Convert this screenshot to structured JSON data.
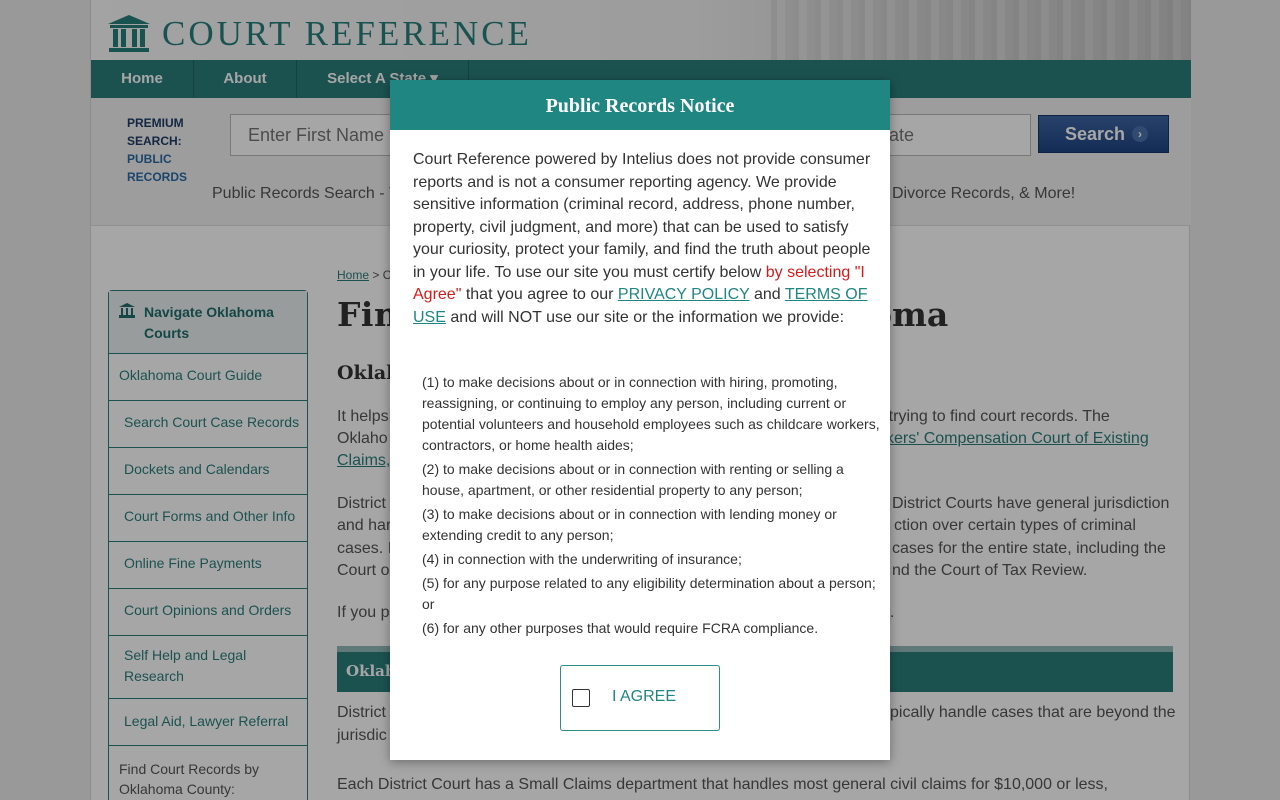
{
  "brand": {
    "name": "COURT REFERENCE",
    "color": "#27807c"
  },
  "nav": {
    "home": "Home",
    "about": "About",
    "select_state": "Select A State"
  },
  "search": {
    "premium_label_1": "PREMIUM",
    "premium_label_2": "SEARCH:",
    "premium_label_3": "PUBLIC",
    "premium_label_4": "RECORDS",
    "first_name_placeholder": "Enter First Name",
    "state_placeholder": "State",
    "button": "Search",
    "tagline_left": "Public Records Search - Y",
    "tagline_right": "Divorce Records, & More!"
  },
  "sidebar": {
    "heading": "Navigate Oklahoma Courts",
    "items": [
      "Oklahoma Court Guide",
      "Search Court Case Records",
      "Dockets and Calendars",
      "Court Forms and Other Info",
      "Online Fine Payments",
      "Court Opinions and Orders",
      "Self Help and Legal Research",
      "Legal Aid, Lawyer Referral",
      "Find Court Records by Oklahoma County:"
    ]
  },
  "main": {
    "breadcrumb_home": "Home",
    "breadcrumb_rest": " > O",
    "title_left": "Fin",
    "title_right": "oma",
    "subtitle": "Oklah",
    "p1_l1_left": "It helps",
    "p1_l1_right": "re trying to find court records. The",
    "p1_l2_left": "Oklaho",
    "p1_l2_link": "kers' Compensation Court of Existing",
    "p1_l3_link": "Claims,",
    "p2_l1_left": "District",
    "p2_l1_right": "District Courts have general jurisdiction",
    "p2_l2_left": "and har",
    "p2_l2_right": "ction over certain types of criminal",
    "p2_l3_left": "cases. I",
    "p2_l3_right": "cases for the entire state, including the",
    "p2_l4_left": "Court o",
    "p2_l4_right": "nd the Court of Tax Review.",
    "p3_left": "If you p",
    "p3_right": ".",
    "bar_label": "Oklah",
    "p4_l1_left": "District",
    "p4_l1_right": "pically handle cases that are beyond the",
    "p4_l2_left": "jurisdic",
    "p5": "Each District Court has a Small Claims department that handles most general civil claims for $10,000 or less,"
  },
  "modal": {
    "title": "Public Records Notice",
    "notice_1": "Court Reference powered by Intelius does not provide consumer reports and is not a consumer reporting agency. We provide sensitive information (criminal record, address, phone number, property, civil judgment, and more) that can be used to satisfy your curiosity, protect your family, and find the truth about people in your life. To use our site you must certify below ",
    "notice_red": "by selecting \"I Agree\"",
    "notice_2": " that you agree to our ",
    "privacy_link": "PRIVACY POLICY",
    "notice_3": " and ",
    "terms_link": "TERMS OF USE",
    "notice_4": " and will NOT use our site or the information we provide:",
    "purposes": [
      "(1) to make decisions about or in connection with hiring, promoting, reassigning, or continuing to employ any person, including current or potential volunteers and household employees such as childcare workers, contractors, or home health aides;",
      "(2) to make decisions about or in connection with renting or selling a house, apartment, or other residential property to any person;",
      "(3) to make decisions about or in connection with lending money or extending credit to any person;",
      "(4) in connection with the underwriting of insurance;",
      "(5) for any purpose related to any eligibility determination about a person; or",
      "(6) for any other purposes that would require FCRA compliance."
    ],
    "agree_label": "I AGREE",
    "agree_checked": false
  }
}
